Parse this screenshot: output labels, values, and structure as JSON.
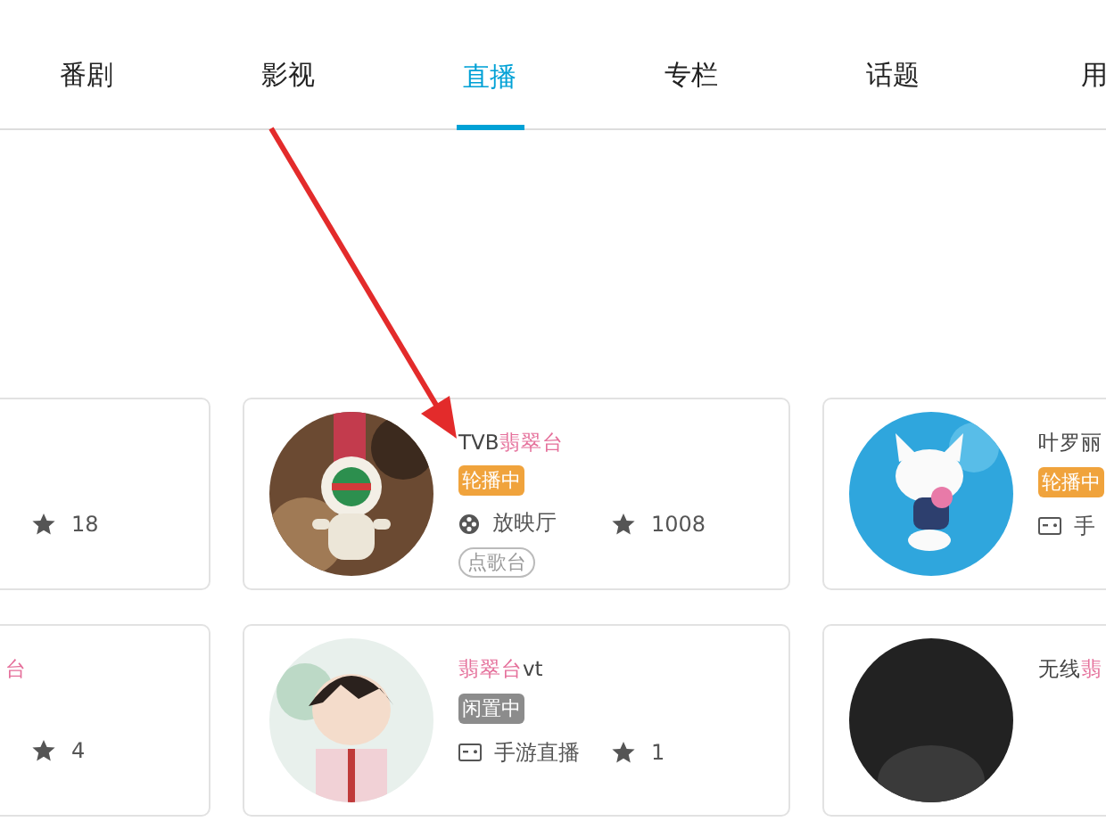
{
  "tabs": [
    {
      "label": "番剧",
      "selected": false
    },
    {
      "label": "影视",
      "selected": false
    },
    {
      "label": "直播",
      "selected": true
    },
    {
      "label": "专栏",
      "selected": false
    },
    {
      "label": "话题",
      "selected": false
    },
    {
      "label": "用",
      "selected": false
    }
  ],
  "cards": [
    {
      "stars": "18"
    },
    {
      "avatar": {
        "kind": "picture"
      },
      "name": [
        {
          "text": "TVB",
          "highlight": false
        },
        {
          "text": "翡翠台",
          "highlight": true
        }
      ],
      "badge": {
        "text": "轮播中",
        "kind": "rotating"
      },
      "category": {
        "text": "放映厅"
      },
      "stars": "1008",
      "tag": "点歌台"
    },
    {
      "avatar": {
        "kind": "picture"
      },
      "name": [
        {
          "text": "叶罗丽",
          "highlight": false
        }
      ],
      "badge": {
        "text": "轮播中",
        "kind": "rotating"
      },
      "category": {
        "text": "手"
      }
    },
    {
      "name": [
        {
          "text": "台",
          "highlight": true
        }
      ],
      "stars": "4"
    },
    {
      "avatar": {
        "kind": "picture"
      },
      "name": [
        {
          "text": "翡翠台",
          "highlight": true
        },
        {
          "text": "vt",
          "highlight": false
        }
      ],
      "badge": {
        "text": "闲置中",
        "kind": "idle"
      },
      "category": {
        "text": "手游直播"
      },
      "stars": "1"
    },
    {
      "avatar": {
        "kind": "picture"
      },
      "name": [
        {
          "text": "无线",
          "highlight": false
        },
        {
          "text": "翡",
          "highlight": true
        }
      ]
    }
  ],
  "annotation": {
    "kind": "arrow"
  }
}
